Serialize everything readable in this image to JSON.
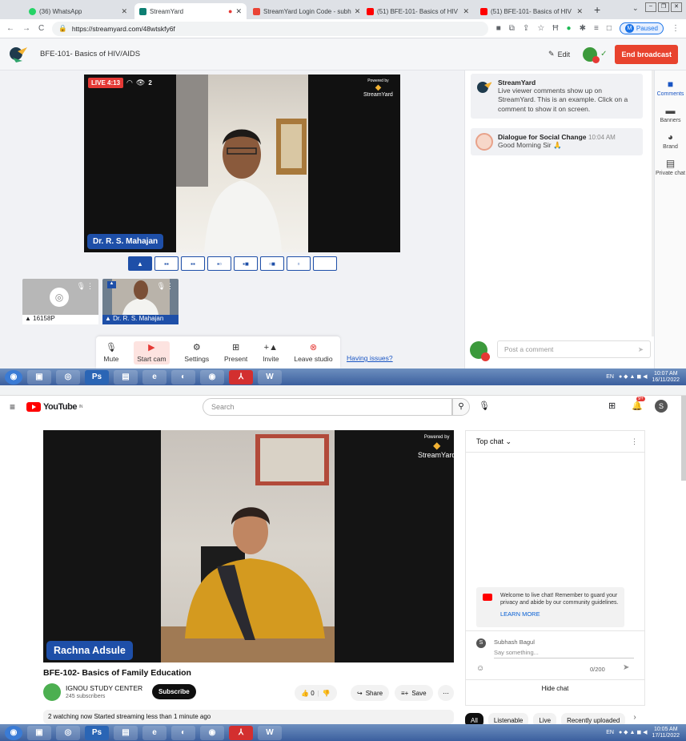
{
  "browser1": {
    "tabs": [
      {
        "label": "(36) WhatsApp"
      },
      {
        "label": "StreamYard"
      },
      {
        "label": "StreamYard Login Code - subh"
      },
      {
        "label": "(51) BFE-101- Basics of HIV"
      },
      {
        "label": "(51) BFE-101- Basics of HIV"
      }
    ],
    "url": "https://streamyard.com/48wtskfy6f",
    "profile_status": "Paused",
    "profile_initial": "M"
  },
  "streamyard": {
    "broadcast_title": "BFE-101- Basics of HIV/AIDS",
    "edit_label": "Edit",
    "end_button": "End broadcast",
    "live_badge": "LIVE 4:13",
    "viewer_count": "2",
    "powered_by": "Powered by",
    "brand": "StreamYard",
    "main_presenter": "Dr. R. S. Mahajan",
    "guests": [
      {
        "label": "16158P"
      },
      {
        "label": "Dr. R. S. Mahajan"
      }
    ],
    "controls": [
      {
        "label": "Mute"
      },
      {
        "label": "Start cam"
      },
      {
        "label": "Settings"
      },
      {
        "label": "Present"
      },
      {
        "label": "Invite"
      },
      {
        "label": "Leave studio"
      }
    ],
    "having_issues": "Having issues?",
    "comments": [
      {
        "author": "StreamYard",
        "time": "",
        "text": "Live viewer comments show up on StreamYard. This is an example. Click on a comment to show it on screen."
      },
      {
        "author": "Dialogue for Social Change",
        "time": "10:04 AM",
        "text": "Good Morning Sir 🙏"
      }
    ],
    "comment_placeholder": "Post a comment",
    "rail": [
      {
        "label": "Comments"
      },
      {
        "label": "Banners"
      },
      {
        "label": "Brand"
      },
      {
        "label": "Private chat"
      }
    ]
  },
  "taskbar1": {
    "lang": "EN",
    "time": "10:07 AM",
    "date": "16/11/2022"
  },
  "youtube": {
    "search_placeholder": "Search",
    "country": "IN",
    "notification_count": "9+",
    "avatar_initial": "S",
    "powered_by": "Powered by",
    "brand": "StreamYard",
    "presenter": "Rachna Adsule",
    "video_title": "BFE-102- Basics of Family Education",
    "channel": "IGNOU STUDY CENTER",
    "subscribers": "245 subscribers",
    "subscribe": "Subscribe",
    "likes": "0",
    "share": "Share",
    "save": "Save",
    "meta": "2 watching now  Started streaming less than 1 minute ago",
    "chat": {
      "mode": "Top chat",
      "welcome": "Welcome to live chat! Remember to guard your privacy and abide by our community guidelines.",
      "learn_more": "LEARN MORE",
      "user": "Subhash Bagul",
      "input_placeholder": "Say something...",
      "counter": "0/200",
      "hide": "Hide chat"
    },
    "chips": [
      {
        "label": "All"
      },
      {
        "label": "Listenable"
      },
      {
        "label": "Live"
      },
      {
        "label": "Recently uploaded"
      }
    ]
  },
  "taskbar2": {
    "lang": "EN",
    "time": "10:05 AM",
    "date": "17/11/2022"
  }
}
